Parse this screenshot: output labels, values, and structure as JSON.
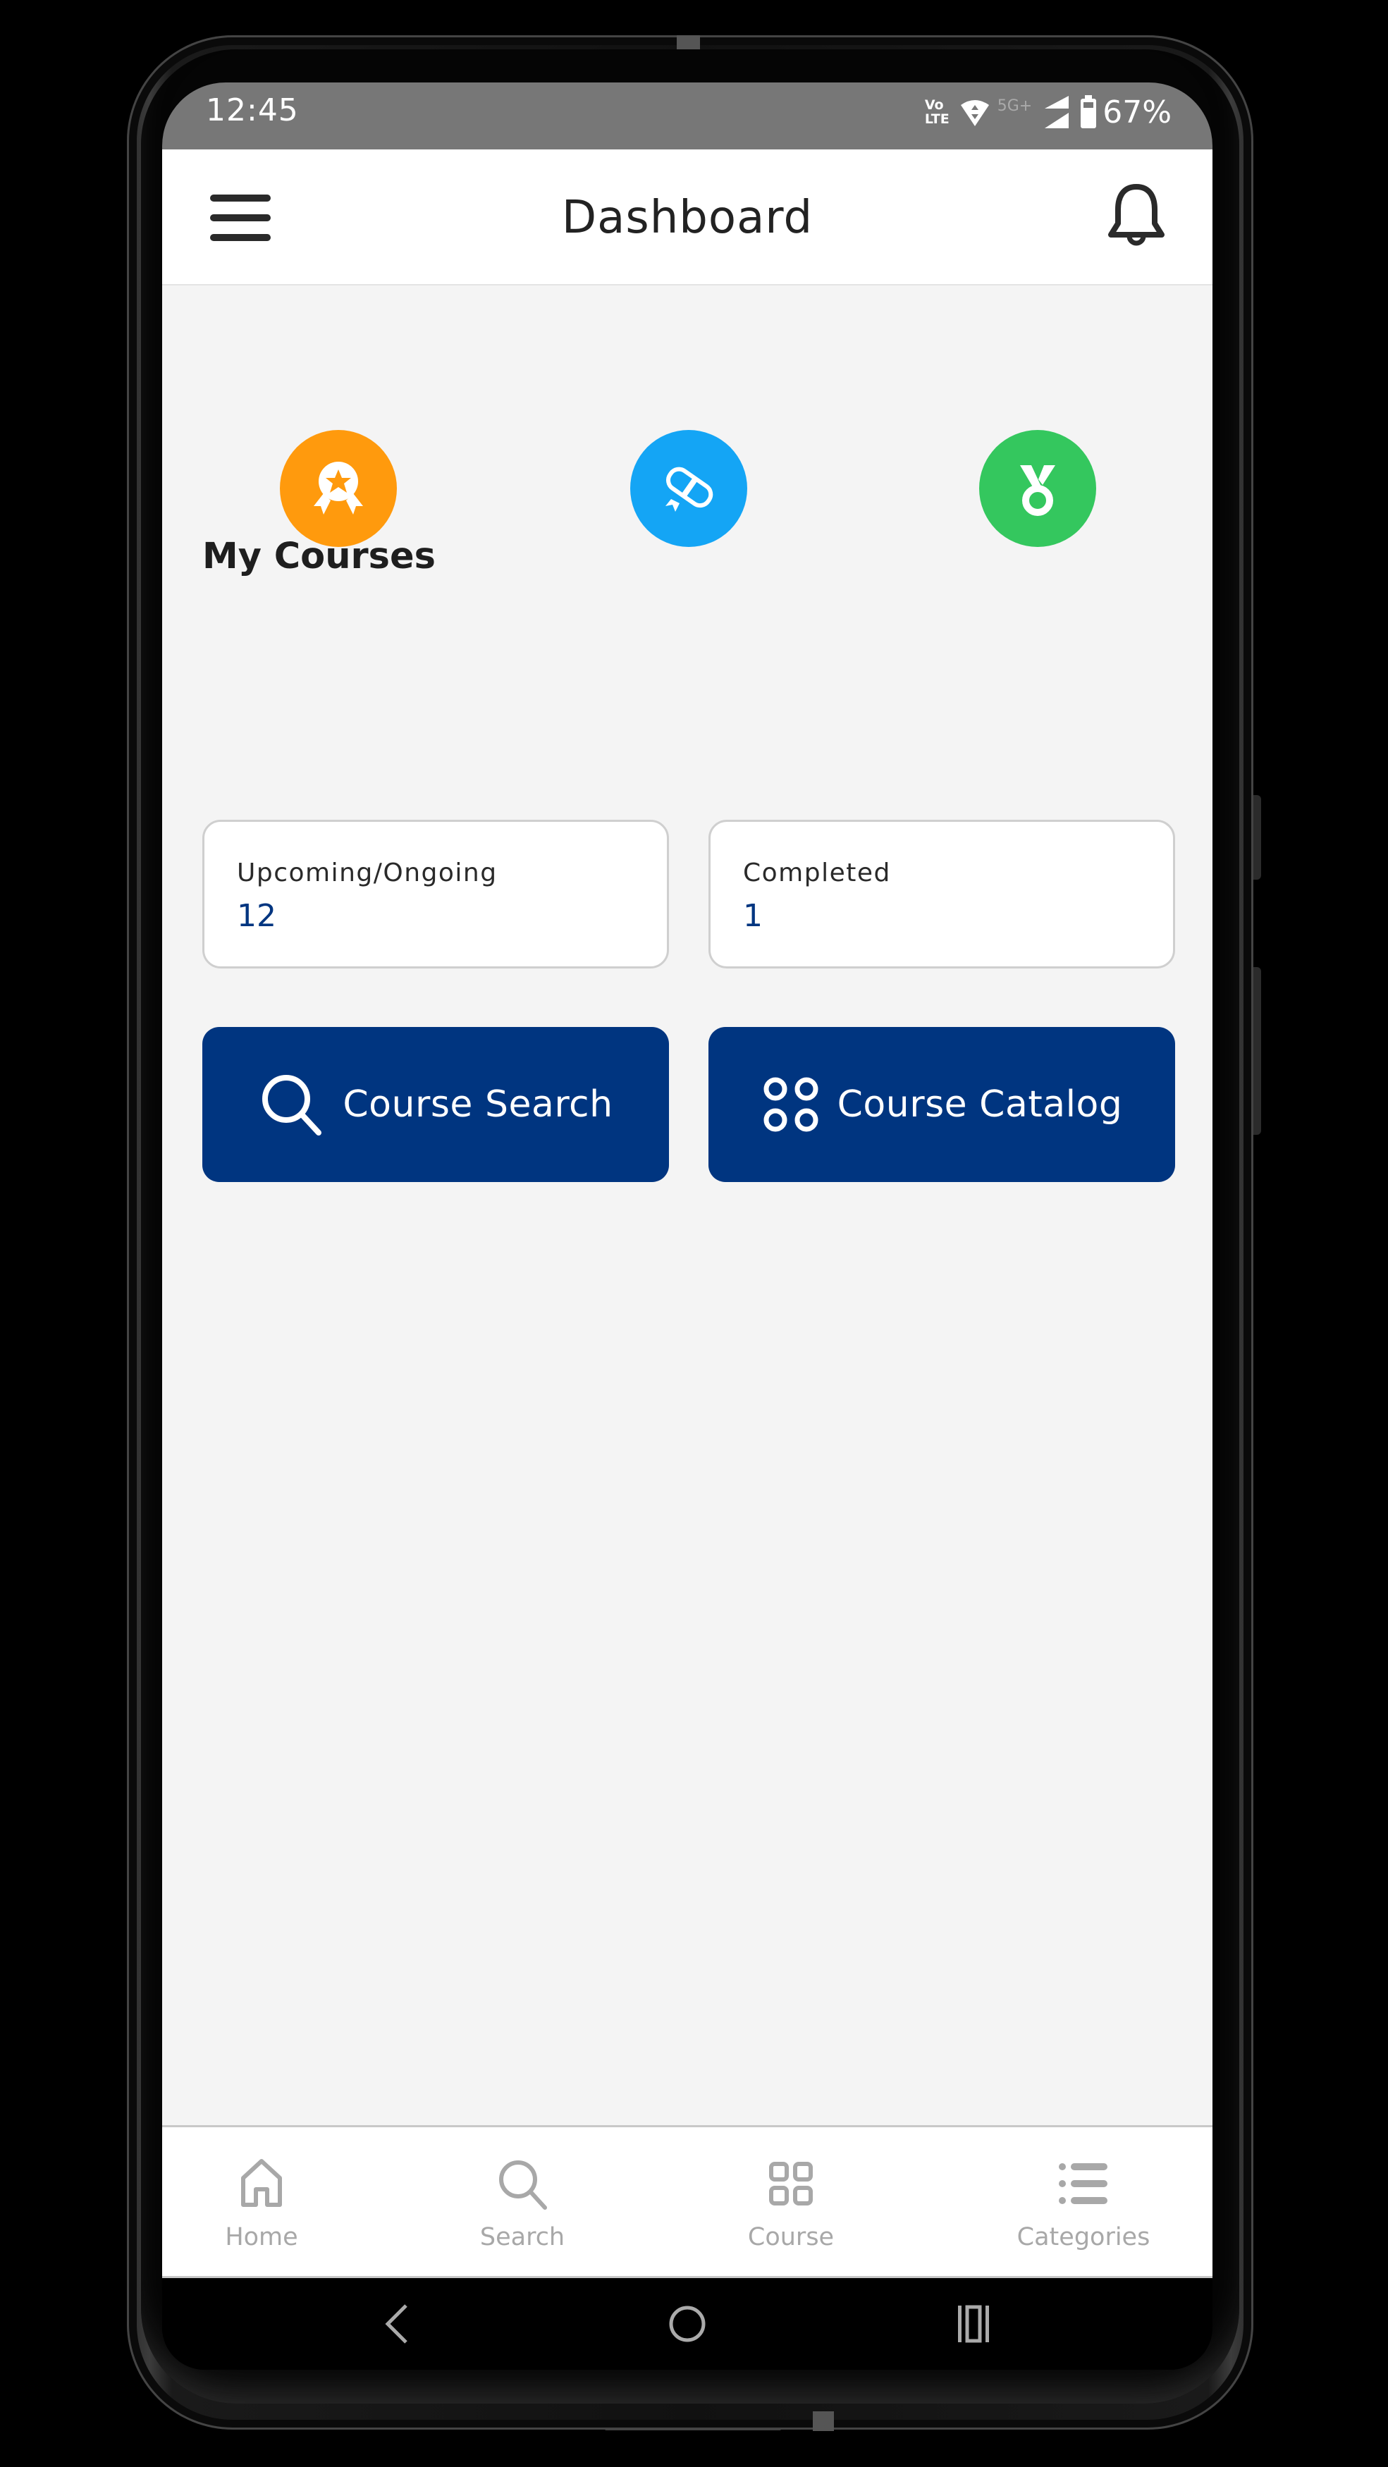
{
  "status_bar": {
    "time": "12:45",
    "volte_top": "Vo",
    "volte_bottom": "LTE",
    "network_type": "5G+",
    "battery_percent": "67%",
    "icons": [
      "volte-icon",
      "wifi-icon",
      "signal-icon",
      "battery-icon"
    ]
  },
  "header": {
    "title": "Dashboard",
    "menu_icon": "hamburger-menu-icon",
    "notification_icon": "bell-icon"
  },
  "badges": [
    {
      "name": "award-badge",
      "icon": "award-ribbon-icon",
      "color": "#FF9A0D"
    },
    {
      "name": "certificate-badge",
      "icon": "diploma-scroll-icon",
      "color": "#14A5F5"
    },
    {
      "name": "medal-badge",
      "icon": "medal-icon",
      "color": "#34C75E"
    }
  ],
  "my_courses": {
    "title": "My Courses",
    "cards": [
      {
        "label": "Upcoming/Ongoing",
        "value": "12"
      },
      {
        "label": "Completed",
        "value": "1"
      }
    ]
  },
  "actions": [
    {
      "label": "Course Search",
      "icon": "search-icon"
    },
    {
      "label": "Course Catalog",
      "icon": "catalog-grid-icon"
    }
  ],
  "bottom_nav": {
    "items": [
      {
        "label": "Home",
        "icon": "home-icon"
      },
      {
        "label": "Search",
        "icon": "search-icon"
      },
      {
        "label": "Course",
        "icon": "grid-icon"
      },
      {
        "label": "Categories",
        "icon": "list-icon"
      }
    ]
  },
  "system_nav": {
    "buttons": [
      "back-icon",
      "home-circle-icon",
      "recents-icon"
    ]
  },
  "colors": {
    "primary": "#003580",
    "background": "#F4F4F4",
    "status_bar": "#777777",
    "nav_inactive": "#A8A8A8"
  }
}
